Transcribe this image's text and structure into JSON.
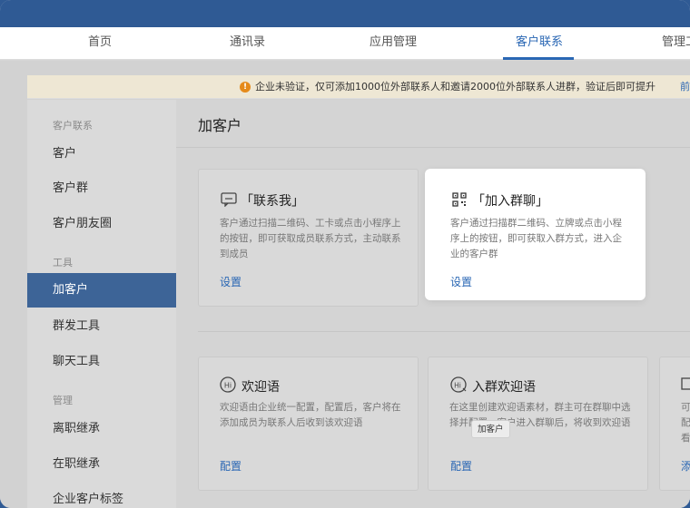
{
  "nav": {
    "tabs": [
      "首页",
      "通讯录",
      "应用管理",
      "客户联系",
      "管理工"
    ],
    "active_index": 3
  },
  "notice": {
    "icon": "warning-icon",
    "text": "企业未验证，仅可添加1000位外部联系人和邀请2000位外部联系人进群，验证后即可提升",
    "link": "前往验证"
  },
  "sidebar": {
    "group_customer": "客户联系",
    "customer": "客户",
    "customer_group": "客户群",
    "moments": "客户朋友圈",
    "group_tools": "工具",
    "add_customer": "加客户",
    "mass_send": "群发工具",
    "chat_tools": "聊天工具",
    "group_manage": "管理",
    "resign_inherit": "离职继承",
    "onjob_inherit": "在职继承",
    "tags": "企业客户标签",
    "active": "add_customer"
  },
  "main": {
    "title": "加客户",
    "cards": [
      {
        "title": "「联系我」",
        "desc": "客户通过扫描二维码、工卡或点击小程序上的按钮，即可获取成员联系方式，主动联系到成员",
        "link": "设置",
        "icon": "chat-window-icon"
      },
      {
        "title": "「加入群聊」",
        "desc": "客户通过扫描群二维码、立牌或点击小程序上的按钮，即可获取入群方式，进入企业的客户群",
        "link": "设置",
        "icon": "qr-code-icon"
      },
      {
        "title": "欢迎语",
        "desc": "欢迎语由企业统一配置，配置后，客户将在添加成员为联系人后收到该欢迎语",
        "link": "配置",
        "icon": "hi-bubble-icon"
      },
      {
        "title": "入群欢迎语",
        "desc": "在这里创建欢迎语素材，群主可在群聊中选择并配置，客户进入群聊后，将收到欢迎语",
        "link": "配置",
        "icon": "group-hi-icon"
      },
      {
        "title_partial": "",
        "desc_partial": [
          "可",
          "配",
          "看"
        ],
        "link_partial": "添"
      }
    ],
    "tooltip": "加客户"
  },
  "colors": {
    "accent": "#2a67b4",
    "sidebar_active": "#3d6497",
    "warning": "#e58a1a",
    "top_bar": "#2f5a94"
  }
}
